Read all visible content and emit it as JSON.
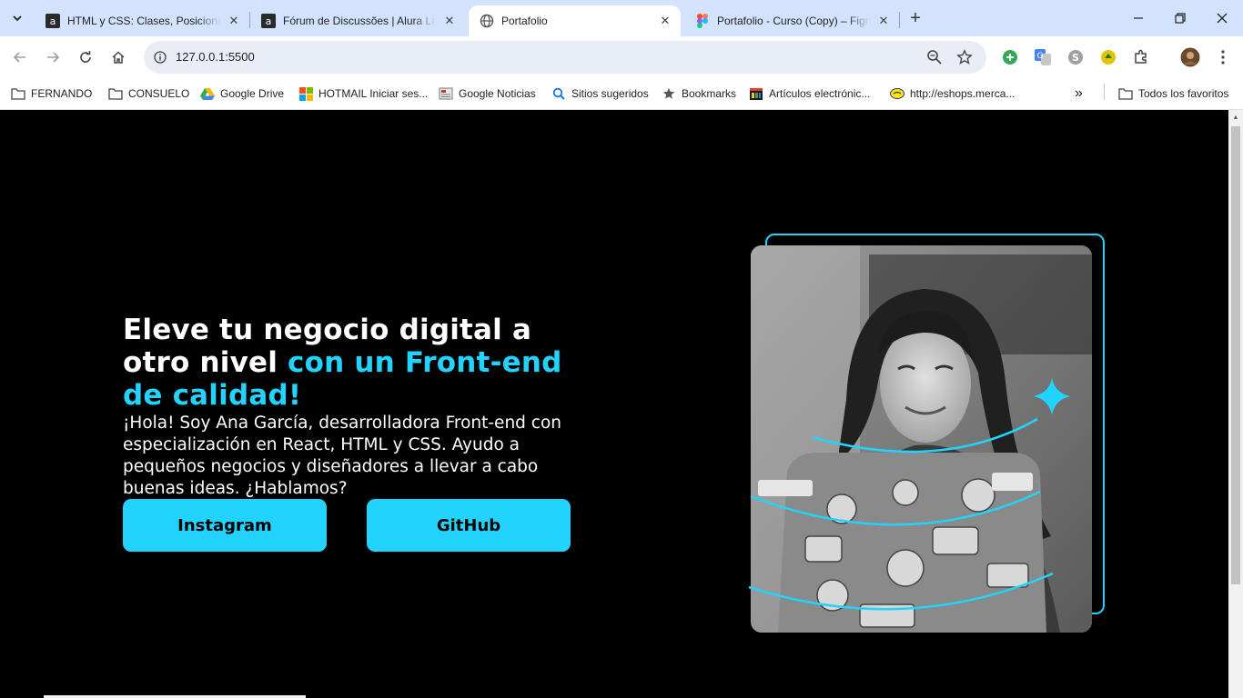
{
  "tabs": [
    {
      "title": "HTML y CSS: Clases, Posicionamiento",
      "favicon": "alura-icon",
      "active": false
    },
    {
      "title": "Fórum de Discussões | Alura Latam",
      "favicon": "alura-icon",
      "active": false
    },
    {
      "title": "Portafolio",
      "favicon": "globe-icon",
      "active": true
    },
    {
      "title": "Portafolio - Curso (Copy) – Figma",
      "favicon": "figma-icon",
      "active": false
    }
  ],
  "address_bar": {
    "url": "127.0.0.1:5500"
  },
  "bookmarks": [
    {
      "label": "FERNANDO",
      "icon": "folder-icon"
    },
    {
      "label": "CONSUELO",
      "icon": "folder-icon"
    },
    {
      "label": "Google Drive",
      "icon": "drive-icon"
    },
    {
      "label": "HOTMAIL Iniciar ses...",
      "icon": "windows-icon"
    },
    {
      "label": "Google Noticias",
      "icon": "news-icon"
    },
    {
      "label": "Sitios sugeridos",
      "icon": "search-icon"
    },
    {
      "label": "Bookmarks",
      "icon": "star-icon"
    },
    {
      "label": "Artículos electrónic...",
      "icon": "shop-icon"
    },
    {
      "label": "http://eshops.merca...",
      "icon": "mercadolibre-icon"
    }
  ],
  "all_bookmarks_label": "Todos los favoritos",
  "hero": {
    "title_white": "Eleve tu negocio digital a otro nivel ",
    "title_accent": "con un Front-end de calidad!",
    "description": "¡Hola! Soy Ana García, desarrolladora Front-end con especialización en React, HTML y CSS. Ayudo a pequeños negocios y diseñadores a llevar a cabo buenas ideas. ¿Hablamos?",
    "buttons": [
      "Instagram",
      "GitHub"
    ]
  },
  "colors": {
    "accent": "#22d4fd",
    "background": "#000000",
    "tabstrip": "#d3e3fd"
  }
}
